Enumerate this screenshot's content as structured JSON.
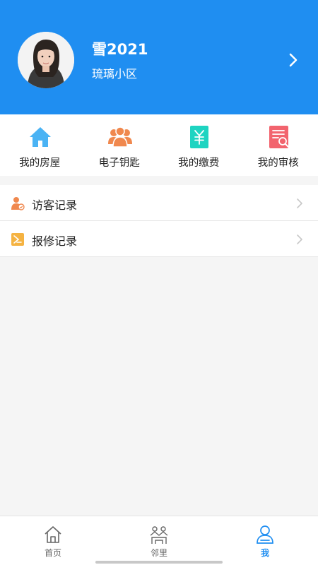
{
  "profile": {
    "name": "雪2021",
    "community": "琉璃小区",
    "avatar_icon": "user-photo",
    "arrow_icon": "chevron-right-icon"
  },
  "quick_actions": [
    {
      "label": "我的房屋",
      "icon": "house-icon",
      "color": "#4ab3f4"
    },
    {
      "label": "电子钥匙",
      "icon": "group-icon",
      "color": "#f0884e"
    },
    {
      "label": "我的缴费",
      "icon": "payment-yuan-icon",
      "color": "#1ed4c1"
    },
    {
      "label": "我的审核",
      "icon": "review-document-icon",
      "color": "#f2646e"
    }
  ],
  "records": [
    {
      "label": "访客记录",
      "icon": "visitor-icon",
      "color": "#f0884e"
    },
    {
      "label": "报修记录",
      "icon": "repair-icon",
      "color": "#f5b342"
    }
  ],
  "tabs": [
    {
      "label": "首页",
      "icon": "home-tab-icon",
      "active": false
    },
    {
      "label": "邻里",
      "icon": "neighborhood-icon",
      "active": false
    },
    {
      "label": "我",
      "icon": "profile-tab-icon",
      "active": true
    }
  ],
  "colors": {
    "brand": "#1f8ef1",
    "background": "#f5f5f5",
    "text": "#222222",
    "inactive_tab": "#666666"
  }
}
